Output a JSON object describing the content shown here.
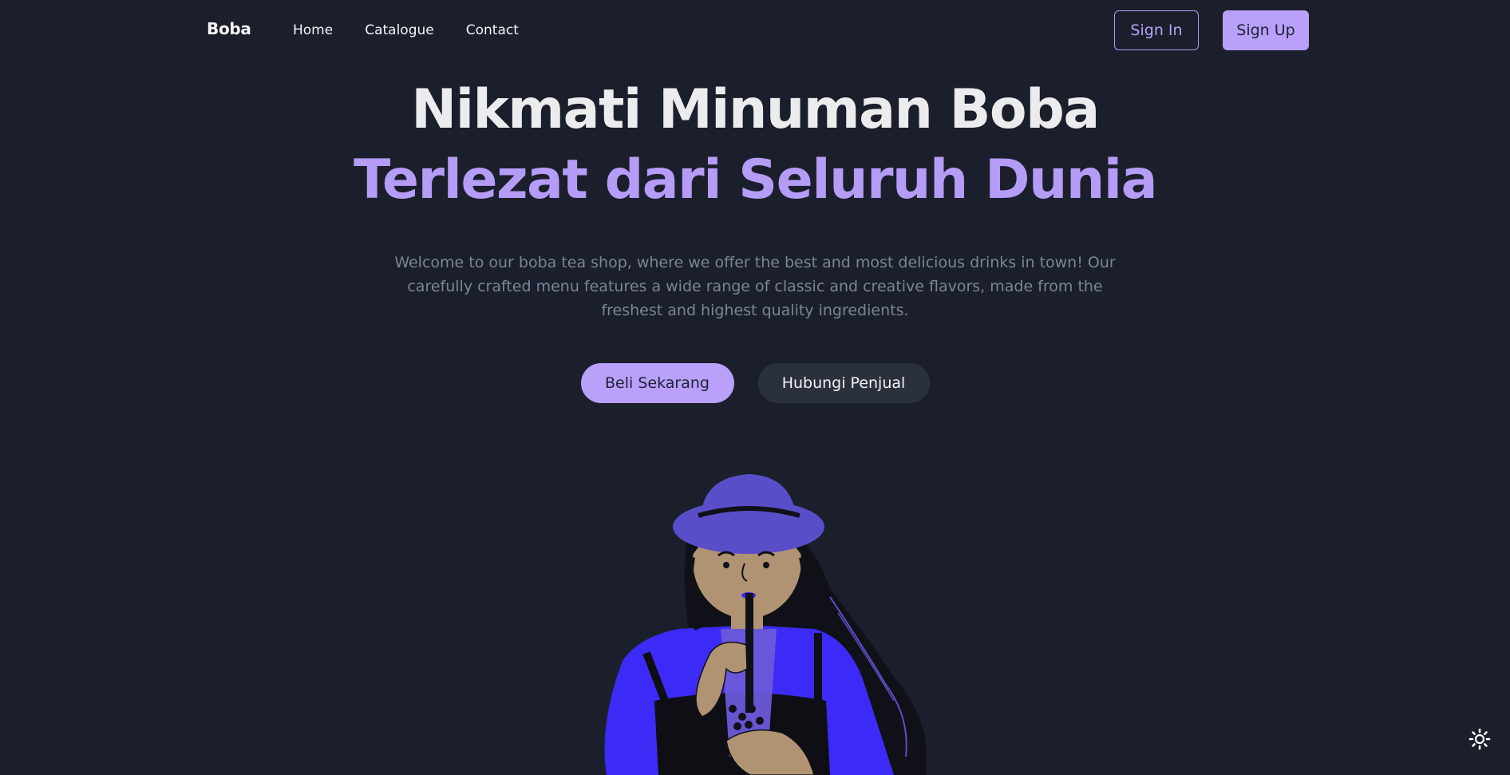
{
  "nav": {
    "brand": "Boba",
    "links": [
      "Home",
      "Catalogue",
      "Contact"
    ],
    "sign_in": "Sign In",
    "sign_up": "Sign Up"
  },
  "hero": {
    "title_line1": "Nikmati Minuman Boba",
    "title_line2": "Terlezat dari Seluruh Dunia",
    "description": "Welcome to our boba tea shop, where we offer the best and most delicious drinks in town! Our carefully crafted menu features a wide range of classic and creative flavors, made from the freshest and highest quality ingredients.",
    "primary_button": "Beli Sekarang",
    "secondary_button": "Hubungi Penjual"
  },
  "colors": {
    "background": "#1b1f2b",
    "accent": "#b8a0fb",
    "title": "#ececee",
    "muted_text": "#7c8598"
  },
  "icons": {
    "theme_toggle": "sun-icon",
    "illustration": "girl-drinking-boba-illustration"
  }
}
